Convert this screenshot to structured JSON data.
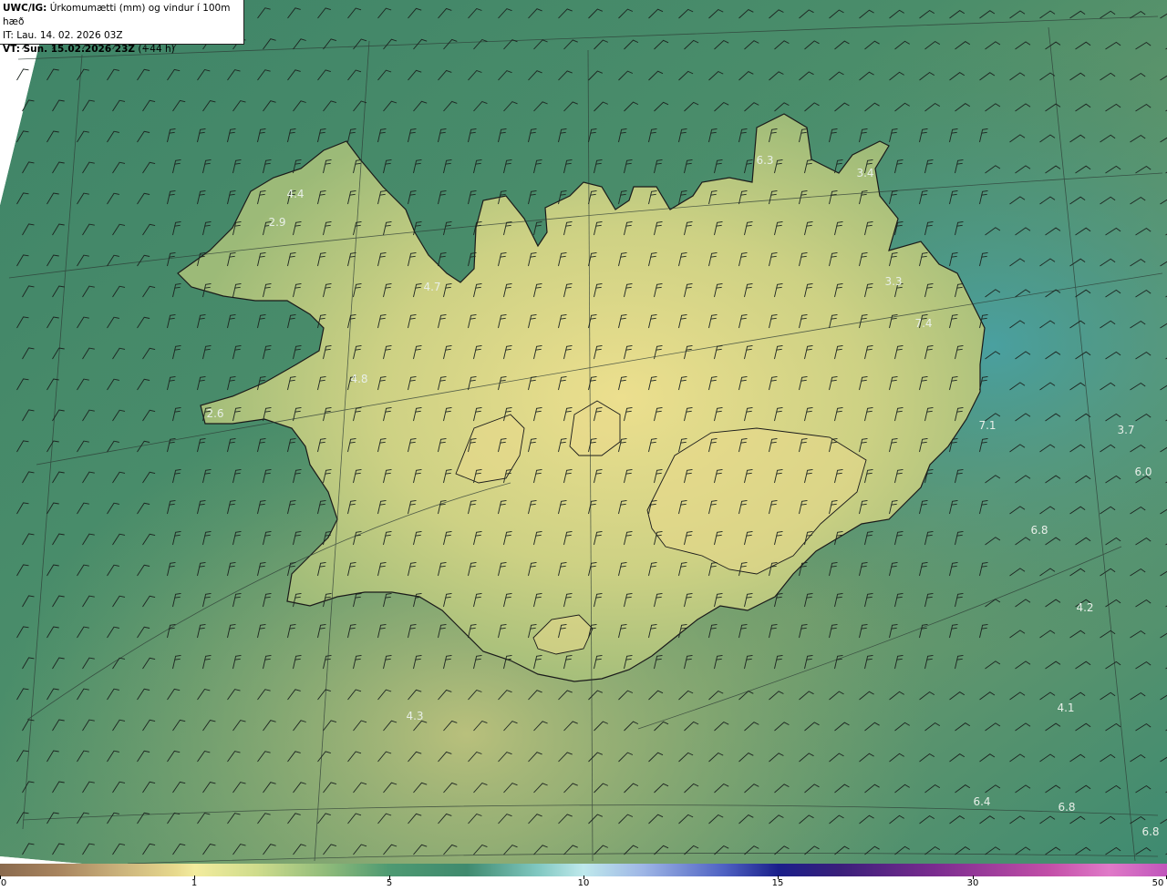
{
  "header": {
    "model": "UWC/IG:",
    "title": "Úrkomumætti (mm) og vindur í 100m hæð",
    "init_time": "IT: Lau. 14. 02. 2026 03Z",
    "valid_label": "VT: Sun. 15.02.2026 23Z",
    "lead": "(+44 h)"
  },
  "map_values": [
    {
      "text": "6.3"
    },
    {
      "text": "3.4"
    },
    {
      "text": "4.4"
    },
    {
      "text": "2.9"
    },
    {
      "text": "4.7"
    },
    {
      "text": "3.3"
    },
    {
      "text": "7.4"
    },
    {
      "text": "4.8"
    },
    {
      "text": "2.6"
    },
    {
      "text": "7.1"
    },
    {
      "text": "3.7"
    },
    {
      "text": "6.0"
    },
    {
      "text": "6.8"
    },
    {
      "text": "4.2"
    },
    {
      "text": "4.3"
    },
    {
      "text": "4.1"
    },
    {
      "text": "6.4"
    },
    {
      "text": "6.8"
    },
    {
      "text": "6.8"
    }
  ],
  "legend": {
    "ticks": [
      "0",
      "1",
      "5",
      "10",
      "15",
      "30",
      "50"
    ]
  },
  "colors": {
    "ocean": "#3f8168",
    "land": "#c9cf82",
    "coast": "#1a1a1a",
    "grid": "#2c3a34"
  }
}
